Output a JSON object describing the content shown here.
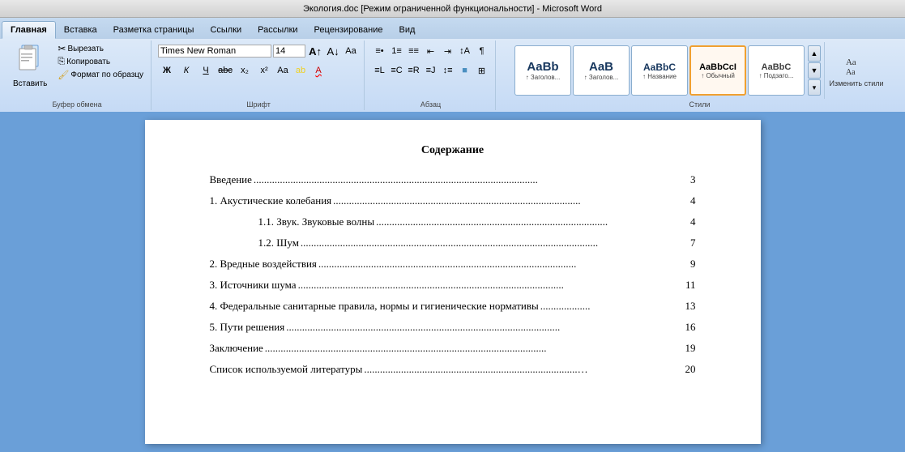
{
  "titleBar": {
    "text": "Экология.doc [Режим ограниченной функциональности] - Microsoft Word"
  },
  "ribbon": {
    "tabs": [
      {
        "label": "Главная",
        "active": true
      },
      {
        "label": "Вставка",
        "active": false
      },
      {
        "label": "Разметка страницы",
        "active": false
      },
      {
        "label": "Ссылки",
        "active": false
      },
      {
        "label": "Рассылки",
        "active": false
      },
      {
        "label": "Рецензирование",
        "active": false
      },
      {
        "label": "Вид",
        "active": false
      }
    ],
    "groups": {
      "clipboard": {
        "label": "Буфер обмена",
        "paste": "Вставить",
        "cut": "Вырезать",
        "copy": "Копировать",
        "format": "Формат по образцу"
      },
      "font": {
        "label": "Шрифт",
        "fontName": "Times New Roman",
        "fontSize": "14",
        "boldLabel": "Ж",
        "italicLabel": "К",
        "underlineLabel": "Ч"
      },
      "paragraph": {
        "label": "Абзац"
      },
      "styles": {
        "label": "Стили",
        "items": [
          {
            "preview": "AaBb",
            "label": "↑ Заголов...",
            "active": false
          },
          {
            "preview": "AaB",
            "label": "↑ Заголов...",
            "active": false
          },
          {
            "preview": "AaBbC",
            "label": "↑ Название",
            "active": false
          },
          {
            "preview": "AaBbCcI",
            "label": "↑ Обычный",
            "active": true
          },
          {
            "preview": "AaBbC",
            "label": "↑ Подзаго...",
            "active": false
          }
        ],
        "changeStyleLabel": "Изменить стили"
      }
    }
  },
  "document": {
    "toc": {
      "title": "Содержание",
      "entries": [
        {
          "text": "Введение",
          "dots": "............................................................................................................",
          "page": "3",
          "indent": false
        },
        {
          "text": "1. Акустические колебания",
          "dots": "..............................................................................................",
          "page": "4",
          "indent": false
        },
        {
          "text": "1.1. Звук. Звуковые волны",
          "dots": "........................................................................................",
          "page": "4",
          "indent": true
        },
        {
          "text": "1.2. Шум",
          "dots": ".................................................................................................................",
          "page": "7",
          "indent": true
        },
        {
          "text": "2. Вредные воздействия",
          "dots": "..................................................................................................",
          "page": "9",
          "indent": false
        },
        {
          "text": "3. Источники шума",
          "dots": ".....................................................................................................",
          "page": "11",
          "indent": false
        },
        {
          "text": "4. Федеральные санитарные правила, нормы и гигиенические нормативы",
          "dots": "...................",
          "page": "13",
          "indent": false
        },
        {
          "text": "5. Пути решения",
          "dots": "........................................................................................................",
          "page": "16",
          "indent": false
        },
        {
          "text": "Заключение",
          "dots": "...........................................................................................................",
          "page": "19",
          "indent": false
        },
        {
          "text": "Список используемой литературы",
          "dots": ".................................................................................…",
          "page": "20",
          "indent": false
        }
      ]
    }
  }
}
